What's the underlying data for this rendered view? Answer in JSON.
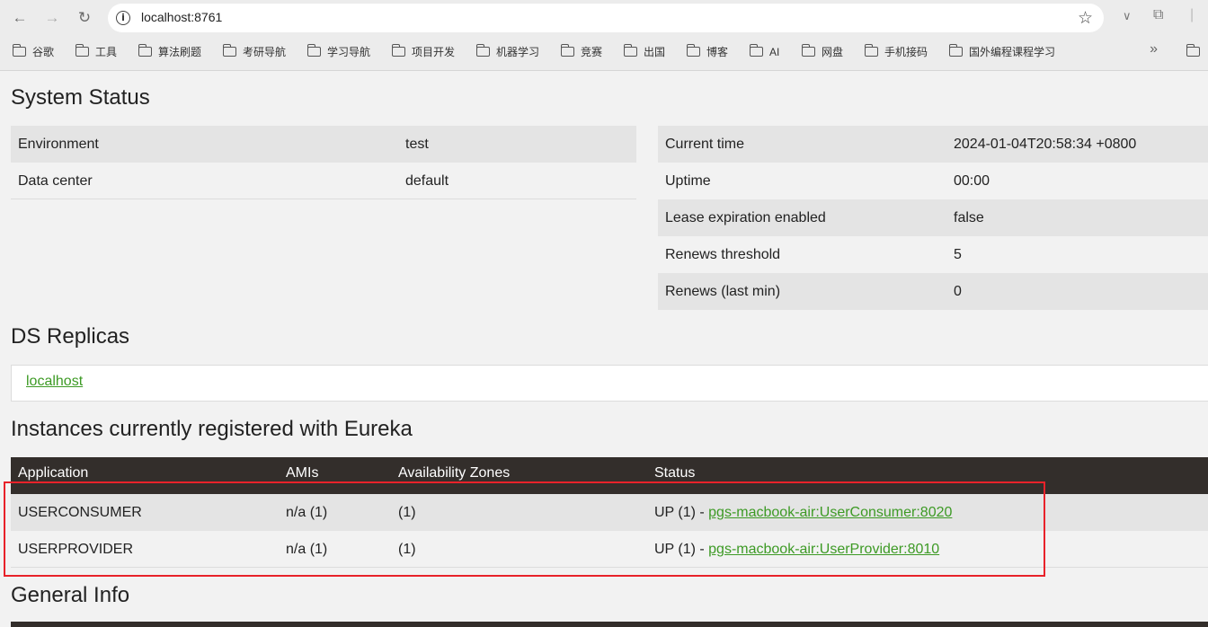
{
  "browser": {
    "url": "localhost:8761",
    "bookmarks": [
      "谷歌",
      "工具",
      "算法刷题",
      "考研导航",
      "学习导航",
      "项目开发",
      "机器学习",
      "竞赛",
      "出国",
      "博客",
      "AI",
      "网盘",
      "手机接码",
      "国外编程课程学习"
    ],
    "more": "»"
  },
  "system_status": {
    "title": "System Status",
    "left": [
      {
        "label": "Environment",
        "value": "test"
      },
      {
        "label": "Data center",
        "value": "default"
      }
    ],
    "right": [
      {
        "label": "Current time",
        "value": "2024-01-04T20:58:34 +0800"
      },
      {
        "label": "Uptime",
        "value": "00:00"
      },
      {
        "label": "Lease expiration enabled",
        "value": "false"
      },
      {
        "label": "Renews threshold",
        "value": "5"
      },
      {
        "label": "Renews (last min)",
        "value": "0"
      }
    ]
  },
  "ds_replicas": {
    "title": "DS Replicas",
    "link": "localhost"
  },
  "instances": {
    "title": "Instances currently registered with Eureka",
    "headers": [
      "Application",
      "AMIs",
      "Availability Zones",
      "Status"
    ],
    "rows": [
      {
        "app": "USERCONSUMER",
        "amis": "n/a (1)",
        "zones": "(1)",
        "status_prefix": "UP (1) - ",
        "status_link": "pgs-macbook-air:UserConsumer:8020"
      },
      {
        "app": "USERPROVIDER",
        "amis": "n/a (1)",
        "zones": "(1)",
        "status_prefix": "UP (1) - ",
        "status_link": "pgs-macbook-air:UserProvider:8010"
      }
    ]
  },
  "general_info": {
    "title": "General Info"
  },
  "colors": {
    "link": "#3d9a25",
    "table_header": "#332e2b",
    "annotation": "#e8222a"
  }
}
